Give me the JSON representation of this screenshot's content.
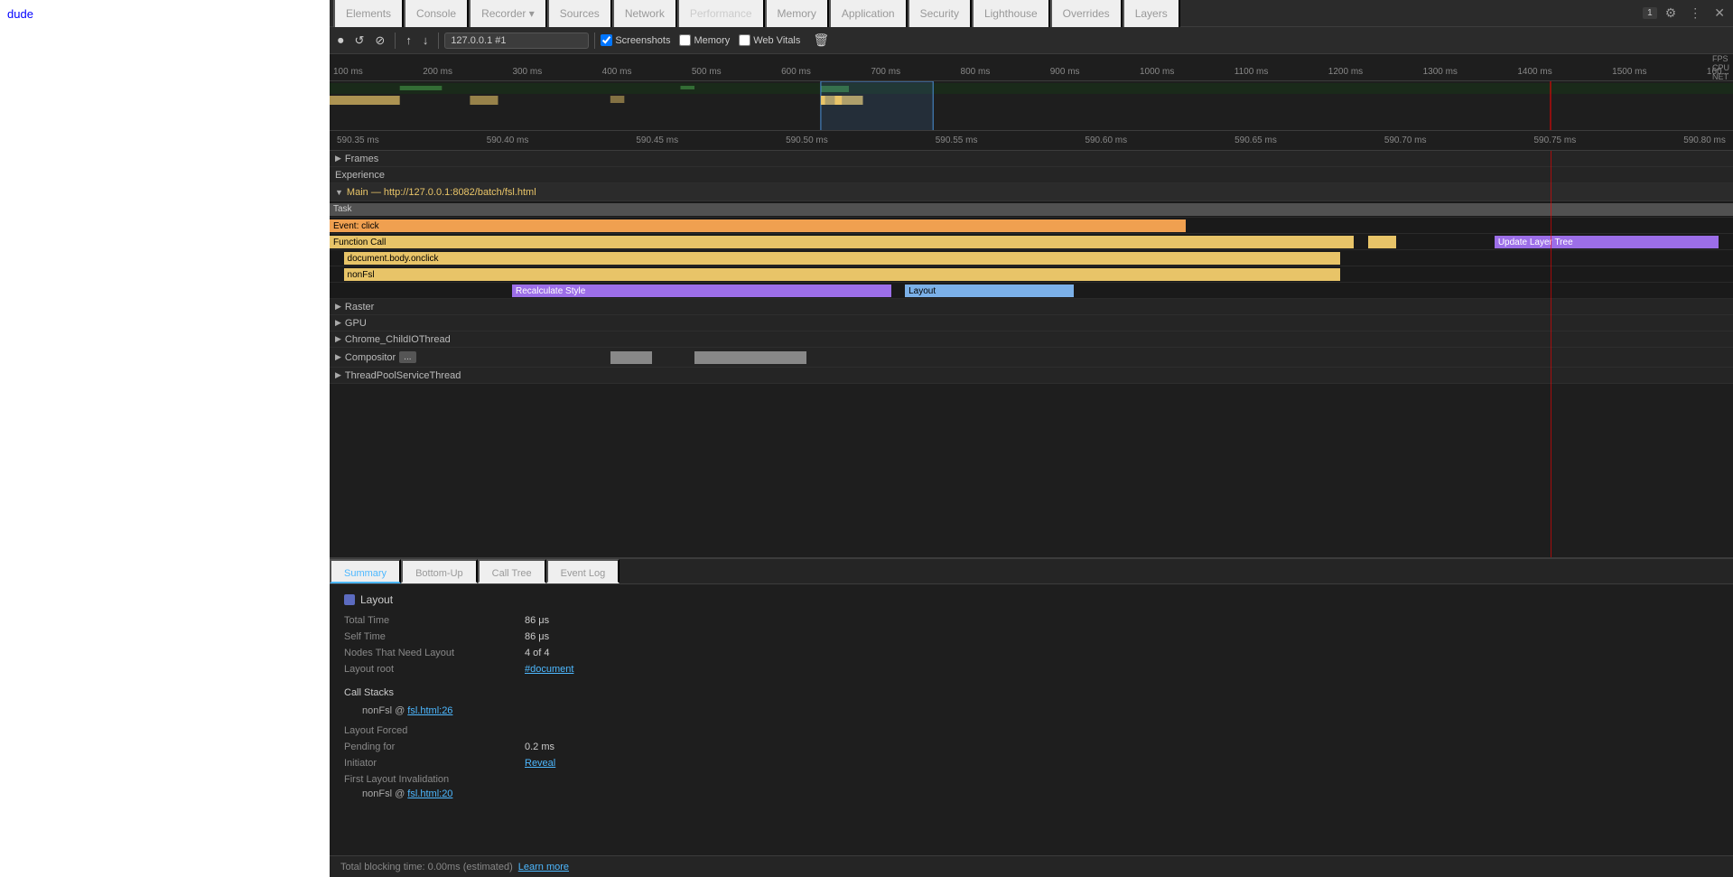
{
  "leftPanel": {
    "text": "dude"
  },
  "devtools": {
    "tabs": [
      {
        "label": "Elements",
        "active": false
      },
      {
        "label": "Console",
        "active": false
      },
      {
        "label": "Recorder ▾",
        "active": false
      },
      {
        "label": "Sources",
        "active": false
      },
      {
        "label": "Network",
        "active": false
      },
      {
        "label": "Performance",
        "active": true
      },
      {
        "label": "Memory",
        "active": false
      },
      {
        "label": "Application",
        "active": false
      },
      {
        "label": "Security",
        "active": false
      },
      {
        "label": "Lighthouse",
        "active": false
      },
      {
        "label": "Overrides",
        "active": false
      },
      {
        "label": "Layers",
        "active": false
      }
    ],
    "toolbar": {
      "recordLabel": "⏺",
      "reloadLabel": "↺",
      "clearLabel": "⊘",
      "uploadLabel": "↑",
      "downloadLabel": "↓",
      "urlValue": "127.0.0.1 #1",
      "screenshotsLabel": "Screenshots",
      "memoryLabel": "Memory",
      "webVitalsLabel": "Web Vitals",
      "trashLabel": "🗑"
    },
    "timelineRuler": {
      "labels": [
        "100 ms",
        "200 ms",
        "300 ms",
        "400 ms",
        "500 ms",
        "600 ms",
        "700 ms",
        "800 ms",
        "900 ms",
        "1000 ms",
        "1100 ms",
        "1200 ms",
        "1300 ms",
        "1400 ms",
        "1500 ms",
        "160..."
      ],
      "rightLabels": [
        "FPS",
        "CPU",
        "NET"
      ]
    },
    "detailRuler": {
      "labels": [
        "590.35 ms",
        "590.40 ms",
        "590.45 ms",
        "590.50 ms",
        "590.55 ms",
        "590.60 ms",
        "590.65 ms",
        "590.70 ms",
        "590.75 ms",
        "590.80 ms"
      ]
    },
    "flameChart": {
      "sections": [
        {
          "label": "Frames",
          "expandable": true
        },
        {
          "label": "Experience",
          "expandable": false
        },
        {
          "label": "Main — http://127.0.0.1:8082/batch/fsl.html",
          "expandable": true,
          "isMain": true
        },
        {
          "label": "Task",
          "bars": [
            {
              "text": "",
              "left": "0%",
              "width": "100%",
              "class": "task-bg-bar"
            }
          ]
        },
        {
          "label": "Event: click",
          "bars": [
            {
              "text": "",
              "left": "0%",
              "width": "62%",
              "class": "event-bar"
            }
          ]
        },
        {
          "label": "Function Call",
          "bars": [
            {
              "text": "",
              "left": "0%",
              "width": "74%",
              "class": "function-bar"
            },
            {
              "text": "Update Layer Tree",
              "left": "83%",
              "width": "16%",
              "class": "update-layer-bar"
            }
          ]
        },
        {
          "label": "document.body.onclick",
          "indent": 2,
          "bars": [
            {
              "text": "document.body.onclick",
              "left": "1.5%",
              "width": "71%",
              "class": "function-bar"
            }
          ]
        },
        {
          "label": "nonFsl",
          "indent": 3,
          "bars": [
            {
              "text": "nonFsl",
              "left": "1.5%",
              "width": "71%",
              "class": "function-bar"
            }
          ]
        },
        {
          "label": "Recalculate Style + Layout",
          "bars": [
            {
              "text": "Recalculate Style",
              "left": "13%",
              "width": "26%",
              "class": "recalc-bar"
            },
            {
              "text": "Layout",
              "left": "41%",
              "width": "12%",
              "class": "layout-bar"
            }
          ]
        },
        {
          "label": "Raster",
          "expandable": true
        },
        {
          "label": "GPU",
          "expandable": true
        },
        {
          "label": "Chrome_ChildIOThread",
          "expandable": true
        },
        {
          "label": "Compositor",
          "expandable": true,
          "tag": "..."
        },
        {
          "label": "ThreadPoolServiceThread",
          "expandable": true
        }
      ]
    },
    "summaryTabs": [
      {
        "label": "Summary",
        "active": true
      },
      {
        "label": "Bottom-Up",
        "active": false
      },
      {
        "label": "Call Tree",
        "active": false
      },
      {
        "label": "Event Log",
        "active": false
      }
    ],
    "summary": {
      "title": "Layout",
      "totalTimeLabel": "Total Time",
      "totalTimeValue": "86 μs",
      "selfTimeLabel": "Self Time",
      "selfTimeValue": "86 μs",
      "nodesLabel": "Nodes That Need Layout",
      "nodesValue": "4 of 4",
      "layoutRootLabel": "Layout root",
      "layoutRootValue": "#document",
      "callStacksTitle": "Call Stacks",
      "callStack1": "nonFsl @ ",
      "callStack1Link": "fsl.html:26",
      "layoutForcedLabel": "Layout Forced",
      "pendingLabel": "Pending for",
      "pendingValue": "0.2 ms",
      "initiatorLabel": "Initiator",
      "initiatorLink": "Reveal",
      "firstLayoutLabel": "First Layout Invalidation",
      "callStack2": "nonFsl @ ",
      "callStack2Link": "fsl.html:20"
    },
    "statusBar": {
      "text": "Total blocking time: 0.00ms (estimated)",
      "linkLabel": "Learn more"
    }
  }
}
